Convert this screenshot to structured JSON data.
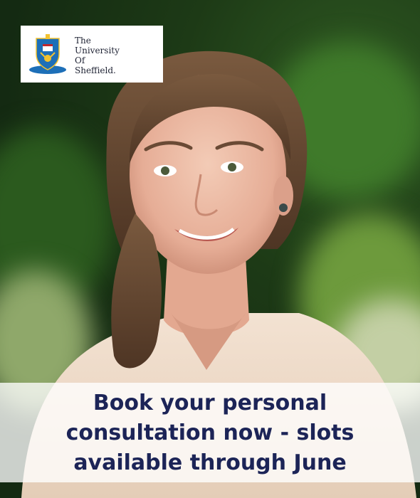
{
  "brand": {
    "name_lines": [
      "The",
      "University",
      "Of",
      "Sheffield."
    ],
    "colors": {
      "navy": "#1c2457",
      "crest_blue": "#1d6fb8",
      "crest_gold": "#f2c230",
      "crest_red": "#c0272d"
    }
  },
  "banner": {
    "lines": [
      "Book your personal",
      "consultation now - slots",
      "available through June"
    ],
    "colors": {
      "text": "#1c2457",
      "background": "#ffffff"
    }
  },
  "photo": {
    "subject": "smiling-woman-portrait"
  }
}
